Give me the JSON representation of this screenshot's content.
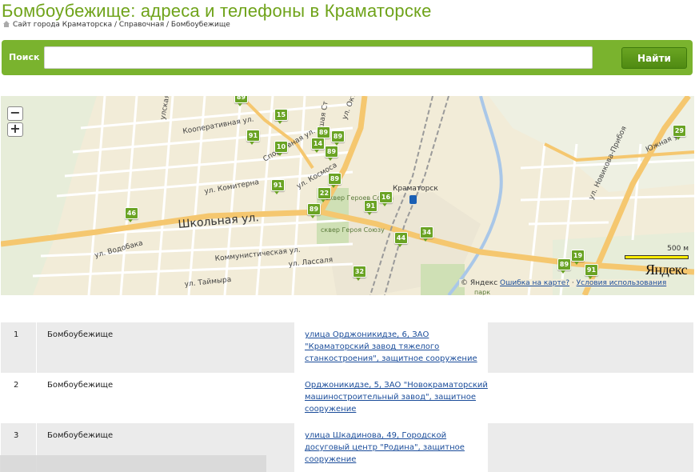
{
  "header": {
    "title": "Бомбоубежище: адреса и телефоны в Краматорске",
    "breadcrumb": "Сайт города Краматорска / Справочная / Бомбоубежище"
  },
  "search": {
    "label": "Поиск",
    "value": "",
    "button_label": "Найти"
  },
  "map": {
    "zoom_out": "−",
    "zoom_in": "+",
    "street_labels": [
      "Школьная ул.",
      "ул. Комитерна",
      "Кооперативная ул.",
      "Коммунистическая ул.",
      "ул. Водобака",
      "ул. Лассаля",
      "ул. Таймыра",
      "Краматорск",
      "ул. Октября",
      "Южная ул.",
      "ул. Новикова-Прибоя",
      "ул. Космоса",
      "Спортивная ул.",
      "Сквер Героев Союза",
      "сквер Героя Союзу",
      "парк",
      "улская",
      "шая Ст"
    ],
    "markers": [
      "89",
      "15",
      "91",
      "10",
      "89",
      "89",
      "14",
      "89",
      "89",
      "91",
      "22",
      "89",
      "16",
      "91",
      "46",
      "44",
      "34",
      "32",
      "29",
      "19",
      "89",
      "91"
    ],
    "scale_label": "500 м",
    "logo": "Яндекс",
    "copyright": "© Яндекс",
    "error_link": "Ошибка на карте?",
    "terms_link": "Условия использования"
  },
  "results": [
    {
      "num": "1",
      "name": "Бомбоубежище",
      "address": "улица Орджоникидзе, 6, ЗАО \"Краматорский завод тяжелого станкостроения\", защитное сооружение"
    },
    {
      "num": "2",
      "name": "Бомбоубежище",
      "address": "Орджоникидзе, 5, ЗАО \"Новокраматорский машиностроительный завод\", защитное сооружение"
    },
    {
      "num": "3",
      "name": "Бомбоубежище",
      "address": "улица Шкадинова, 49, Городской досуговый центр \"Родина\", защитное сооружение"
    }
  ],
  "colors": {
    "accent": "#7ab32e",
    "title": "#6fa31a",
    "link": "#1a4c9a",
    "marker": "#6aa324"
  }
}
